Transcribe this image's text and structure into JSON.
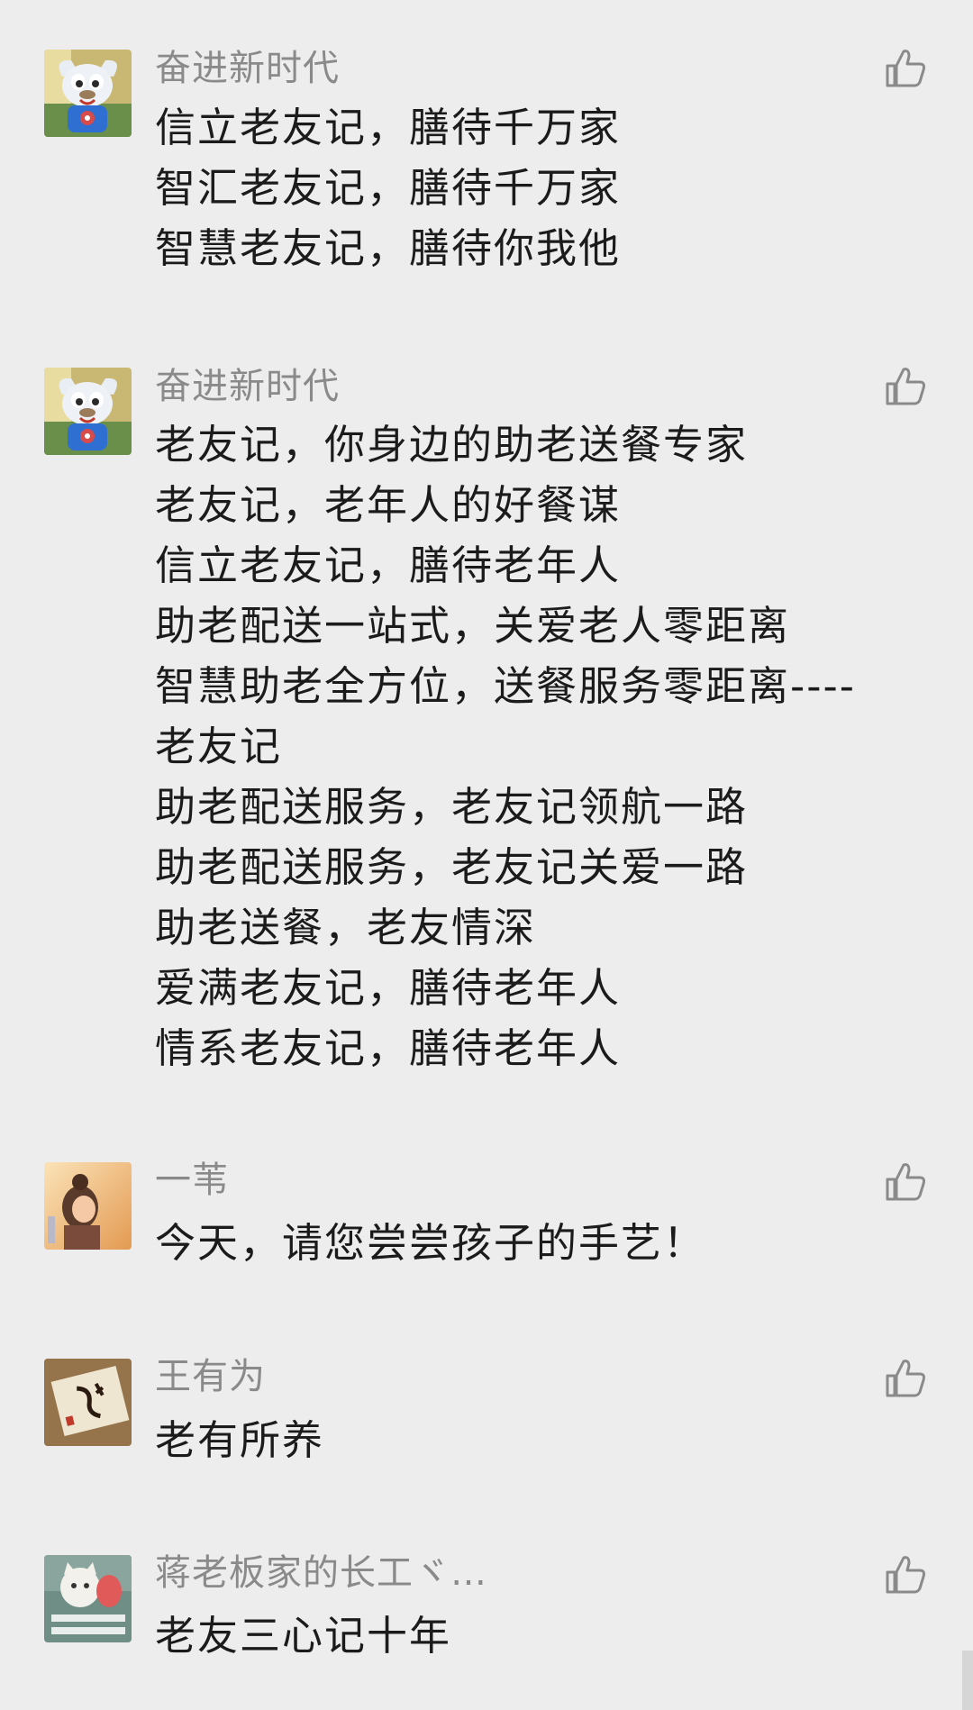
{
  "comments": [
    {
      "author": "奋进新时代",
      "avatar_icon": "cartoon-mascot-avatar",
      "lines": [
        "信立老友记，膳待千万家",
        "智汇老友记，膳待千万家",
        "智慧老友记，膳待你我他"
      ]
    },
    {
      "author": "奋进新时代",
      "avatar_icon": "cartoon-mascot-avatar",
      "lines": [
        "老友记，你身边的助老送餐专家",
        "老友记，老年人的好餐谋",
        "信立老友记，膳待老年人",
        "助老配送一站式，关爱老人零距离",
        "智慧助老全方位，送餐服务零距离----",
        "老友记",
        "助老配送服务，老友记领航一路",
        "助老配送服务，老友记关爱一路",
        "助老送餐，老友情深",
        "爱满老友记，膳待老年人",
        "情系老友记，膳待老年人"
      ]
    },
    {
      "author": "一苇",
      "avatar_icon": "girl-illustration-avatar",
      "lines": [
        "今天，请您尝尝孩子的手艺！"
      ]
    },
    {
      "author": "王有为",
      "avatar_icon": "calligraphy-avatar",
      "lines": [
        "老有所养"
      ]
    },
    {
      "author": "蒋老板家的长工ヾ…",
      "avatar_icon": "cat-sticker-avatar",
      "lines": [
        "老友三心记十年"
      ]
    }
  ],
  "like_icon": "thumbs-up-icon",
  "colors": {
    "background": "#ededed",
    "author_text": "#8a8a8a",
    "body_text": "#1b1b1b",
    "like_icon": "#8a8a8a"
  }
}
